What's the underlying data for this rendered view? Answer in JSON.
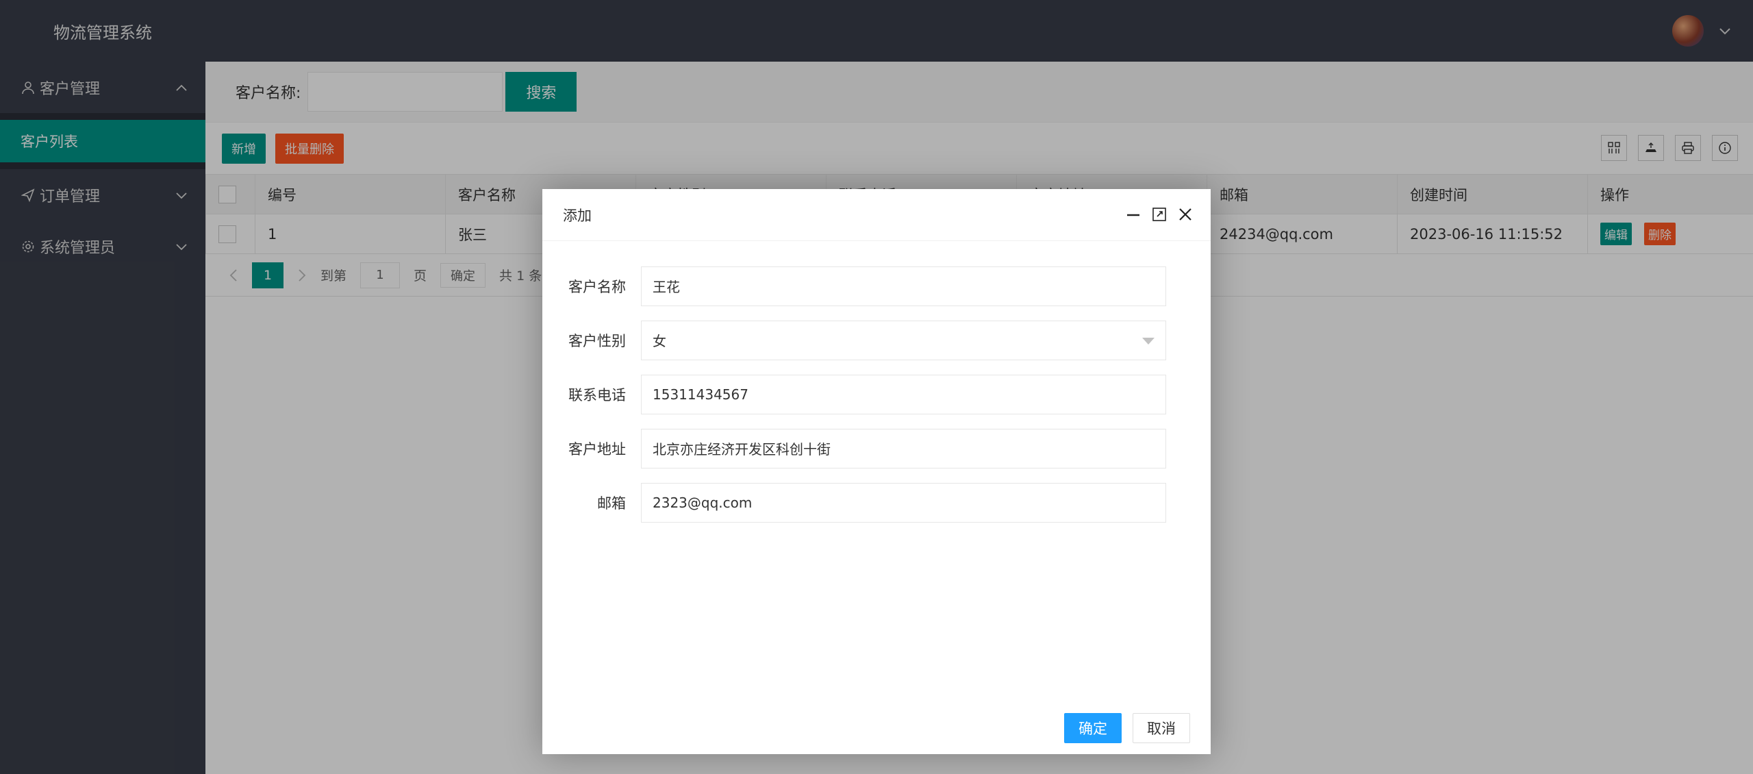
{
  "app": {
    "title": "物流管理系统"
  },
  "sidebar": {
    "groups": [
      {
        "label": "客户管理",
        "icon": "user-icon",
        "expanded": true,
        "items": [
          {
            "label": "客户列表",
            "active": true
          }
        ]
      },
      {
        "label": "订单管理",
        "icon": "send-icon",
        "expanded": false
      },
      {
        "label": "系统管理员",
        "icon": "gear-icon",
        "expanded": false
      }
    ]
  },
  "search": {
    "label": "客户名称:",
    "value": "",
    "button": "搜索"
  },
  "toolbar": {
    "add": "新增",
    "batch_delete": "批量删除"
  },
  "table": {
    "columns": [
      "编号",
      "客户名称",
      "客户性别",
      "联系电话",
      "客户地址",
      "邮箱",
      "创建时间",
      "操作"
    ],
    "rows": [
      {
        "id": "1",
        "name": "张三",
        "email": "24234@qq.com",
        "created": "2023-06-16 11:15:52",
        "edit": "编辑",
        "delete": "删除"
      }
    ]
  },
  "pager": {
    "current": "1",
    "goto": "到第",
    "page_input": "1",
    "page_unit": "页",
    "confirm": "确定",
    "total": "共 1 条",
    "size_partial": "1"
  },
  "dialog": {
    "title": "添加",
    "fields": [
      {
        "label": "客户名称",
        "value": "王花"
      },
      {
        "label": "客户性别",
        "value": "女"
      },
      {
        "label": "联系电话",
        "value": "15311434567"
      },
      {
        "label": "客户地址",
        "value": "北京亦庄经济开发区科创十街"
      },
      {
        "label": "邮箱",
        "value": "2323@qq.com"
      }
    ],
    "ok": "确定",
    "cancel": "取消"
  },
  "colors": {
    "sidebar": "#393d49",
    "accent": "#009688",
    "danger": "#ff5722",
    "primary": "#1e9fff"
  }
}
